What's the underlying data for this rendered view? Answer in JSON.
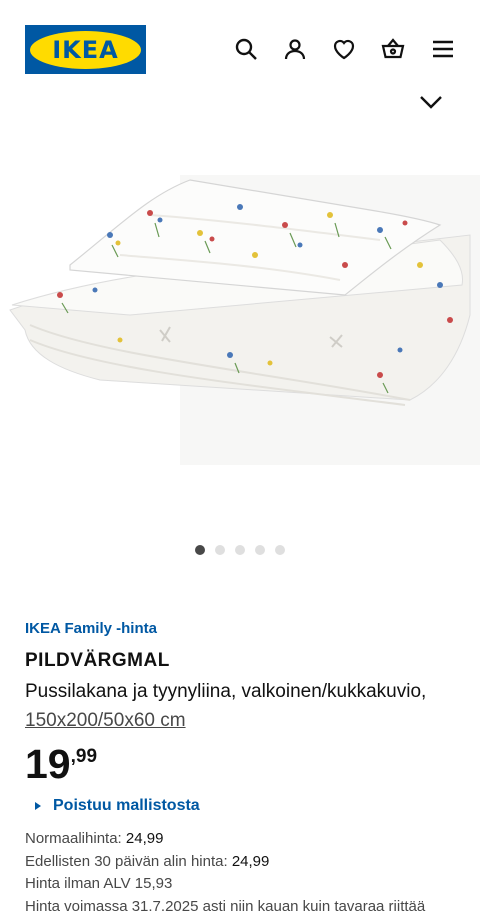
{
  "header": {
    "logo_text": "IKEA",
    "icons": [
      "search-icon",
      "user-icon",
      "heart-icon",
      "basket-icon",
      "menu-icon"
    ]
  },
  "gallery": {
    "image_alt": "PILDVÄRGMAL bedding set, white with floral pattern",
    "dot_count": 5,
    "active_dot": 1
  },
  "product": {
    "family_price_label": "IKEA Family -hinta",
    "name": "PILDVÄRGMAL",
    "description": "Pussilakana ja tyynyliina, valkoinen/kukkakuvio,",
    "size": "150x200/50x60 cm",
    "price_integer": "19",
    "price_decimal": ",99",
    "leaving_label": "Poistuu mallistosta",
    "normal_price_label": "Normaalihinta:",
    "normal_price_value": "24,99",
    "lowest_price_label": "Edellisten 30 päivän alin hinta:",
    "lowest_price_value": "24,99",
    "vat_free_text": "Hinta ilman ALV 15,93",
    "validity_text": "Hinta voimassa 31.7.2025 asti niin kauan kuin tavaraa riittää"
  },
  "colors": {
    "brand_blue": "#0058a3",
    "brand_yellow": "#ffdb00"
  }
}
